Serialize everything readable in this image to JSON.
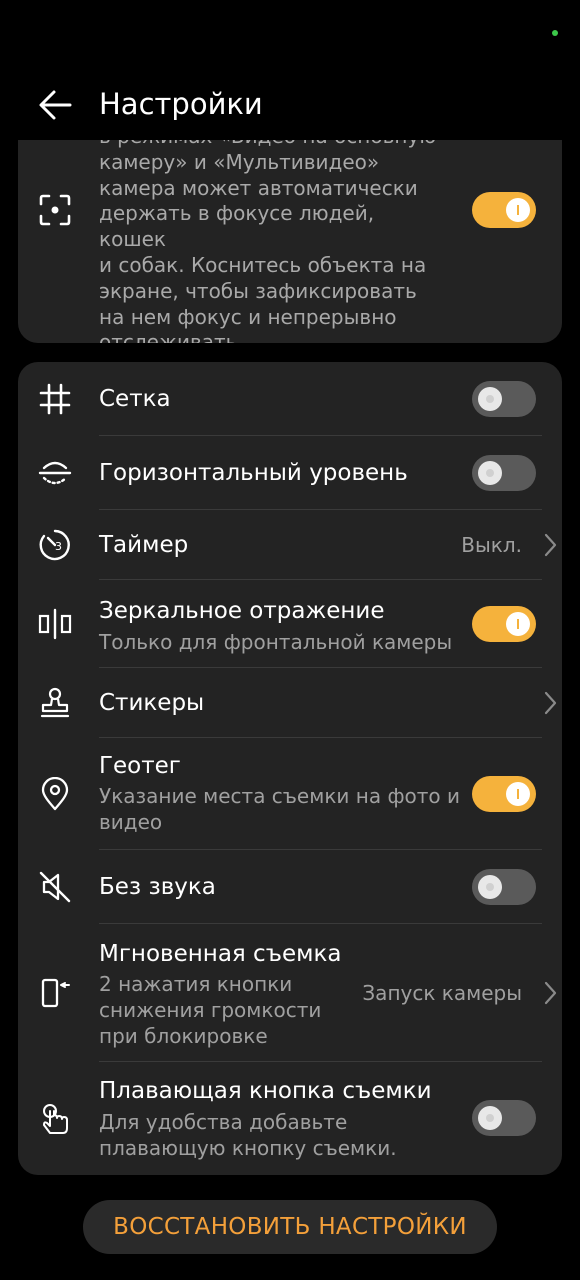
{
  "header": {
    "title": "Настройки"
  },
  "autofocus": {
    "description_partial": "В режимах «Видео на основную камеру» и «Мультивидео» камера может автоматически держать в фокусе людей, кошек и собак. Коснитесь объекта на экране, чтобы зафиксировать на нем фокус и непрерывно отслеживать.",
    "lines": [
      "камеру» и «Мультивидео»",
      "камера может автоматически",
      "держать в фокусе людей, кошек",
      "и собак. Коснитесь объекта на",
      "экране, чтобы зафиксировать",
      "на нем фокус и непрерывно",
      "отслеживать."
    ],
    "first_line_partial": "в режимах «Видео на основную",
    "enabled": true
  },
  "settings": [
    {
      "id": "grid",
      "title": "Сетка",
      "toggle": false
    },
    {
      "id": "level",
      "title": "Горизонтальный уровень",
      "toggle": false
    },
    {
      "id": "timer",
      "title": "Таймер",
      "value": "Выкл."
    },
    {
      "id": "mirror",
      "title": "Зеркальное отражение",
      "subtitle": "Только для фронтальной камеры",
      "toggle": true
    },
    {
      "id": "stickers",
      "title": "Стикеры"
    },
    {
      "id": "geotag",
      "title": "Геотег",
      "subtitle_lines": [
        "Указание места съемки на фото и",
        "видео"
      ],
      "toggle": true
    },
    {
      "id": "mute",
      "title": "Без звука",
      "toggle": false
    },
    {
      "id": "snapshot",
      "title": "Мгновенная съемка",
      "subtitle_lines": [
        "2 нажатия кнопки",
        "снижения громкости",
        "при блокировке"
      ],
      "value": "Запуск камеры"
    },
    {
      "id": "floating",
      "title": "Плавающая кнопка съемки",
      "subtitle_lines": [
        "Для удобства добавьте",
        "плавающую кнопку съемки."
      ],
      "toggle": false
    }
  ],
  "reset_button": {
    "label": "ВОССТАНОВИТЬ НАСТРОЙКИ"
  },
  "colors": {
    "accent": "#f5b23c",
    "card": "#232323",
    "background": "#000000"
  }
}
